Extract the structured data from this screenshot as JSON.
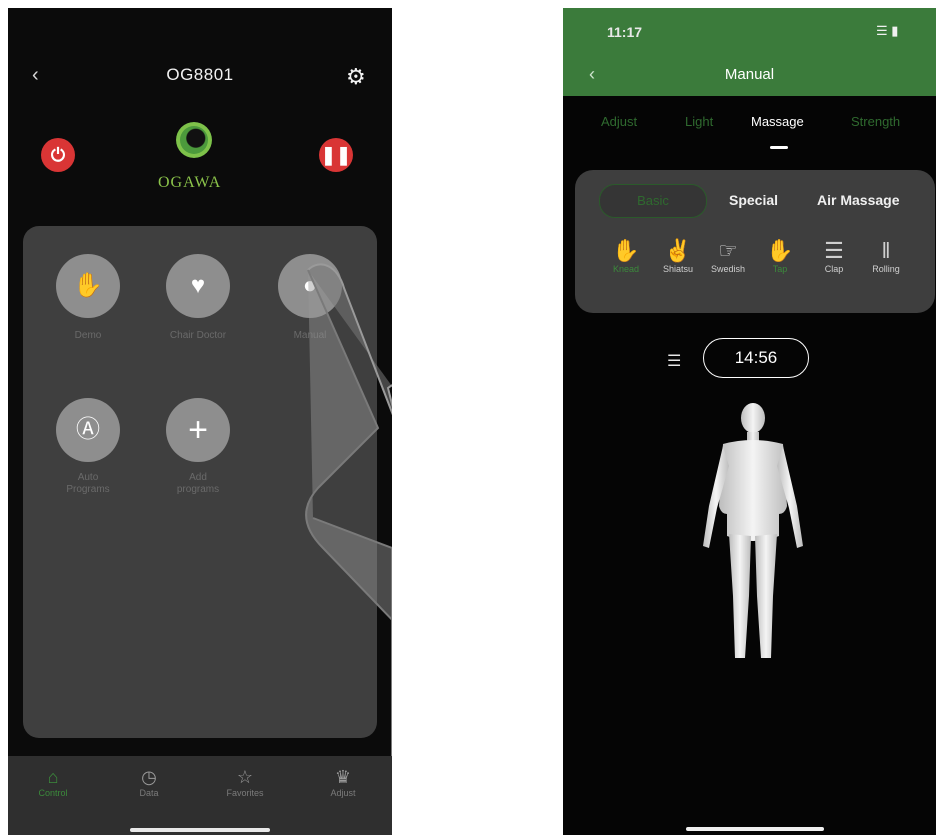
{
  "left_screen": {
    "title": "OG8801",
    "back_icon": "chevron-left-icon",
    "settings_icon": "gear-icon",
    "logo_text": "OGAWA",
    "power_icon": "power-icon",
    "pause_icon": "pause-icon",
    "tiles": [
      {
        "label": "Demo",
        "icon": "hand-icon"
      },
      {
        "label": "Chair Doctor",
        "icon": "heart-pulse-icon"
      },
      {
        "label": "Manual",
        "icon": "manual-icon"
      },
      {
        "label": "Auto\nPrograms",
        "icon": "auto-icon"
      },
      {
        "label": "Add\nprograms",
        "icon": "plus-icon"
      }
    ],
    "tabbar": [
      {
        "label": "Control",
        "icon": "home-icon"
      },
      {
        "label": "Data",
        "icon": "chart-icon"
      },
      {
        "label": "Favorites",
        "icon": "star-icon"
      },
      {
        "label": "Adjust",
        "icon": "chair-icon"
      }
    ]
  },
  "right_screen": {
    "time": "11:17",
    "title": "Manual",
    "tabs": [
      "Adjust",
      "Light",
      "Massage",
      "Strength"
    ],
    "active_tab": "Massage",
    "segments": [
      "Basic",
      "Special",
      "Air Massage"
    ],
    "techniques": [
      {
        "label": "Knead",
        "active": true
      },
      {
        "label": "Shiatsu",
        "active": false
      },
      {
        "label": "Swedish",
        "active": false
      },
      {
        "label": "Tap",
        "active": true
      },
      {
        "label": "Clap",
        "active": false
      },
      {
        "label": "Rolling",
        "active": false
      }
    ],
    "timer": "14:56"
  },
  "colors": {
    "accent_green": "#3b7b3b",
    "power_red": "#d93535",
    "panel_gray": "#3f3f3f"
  }
}
